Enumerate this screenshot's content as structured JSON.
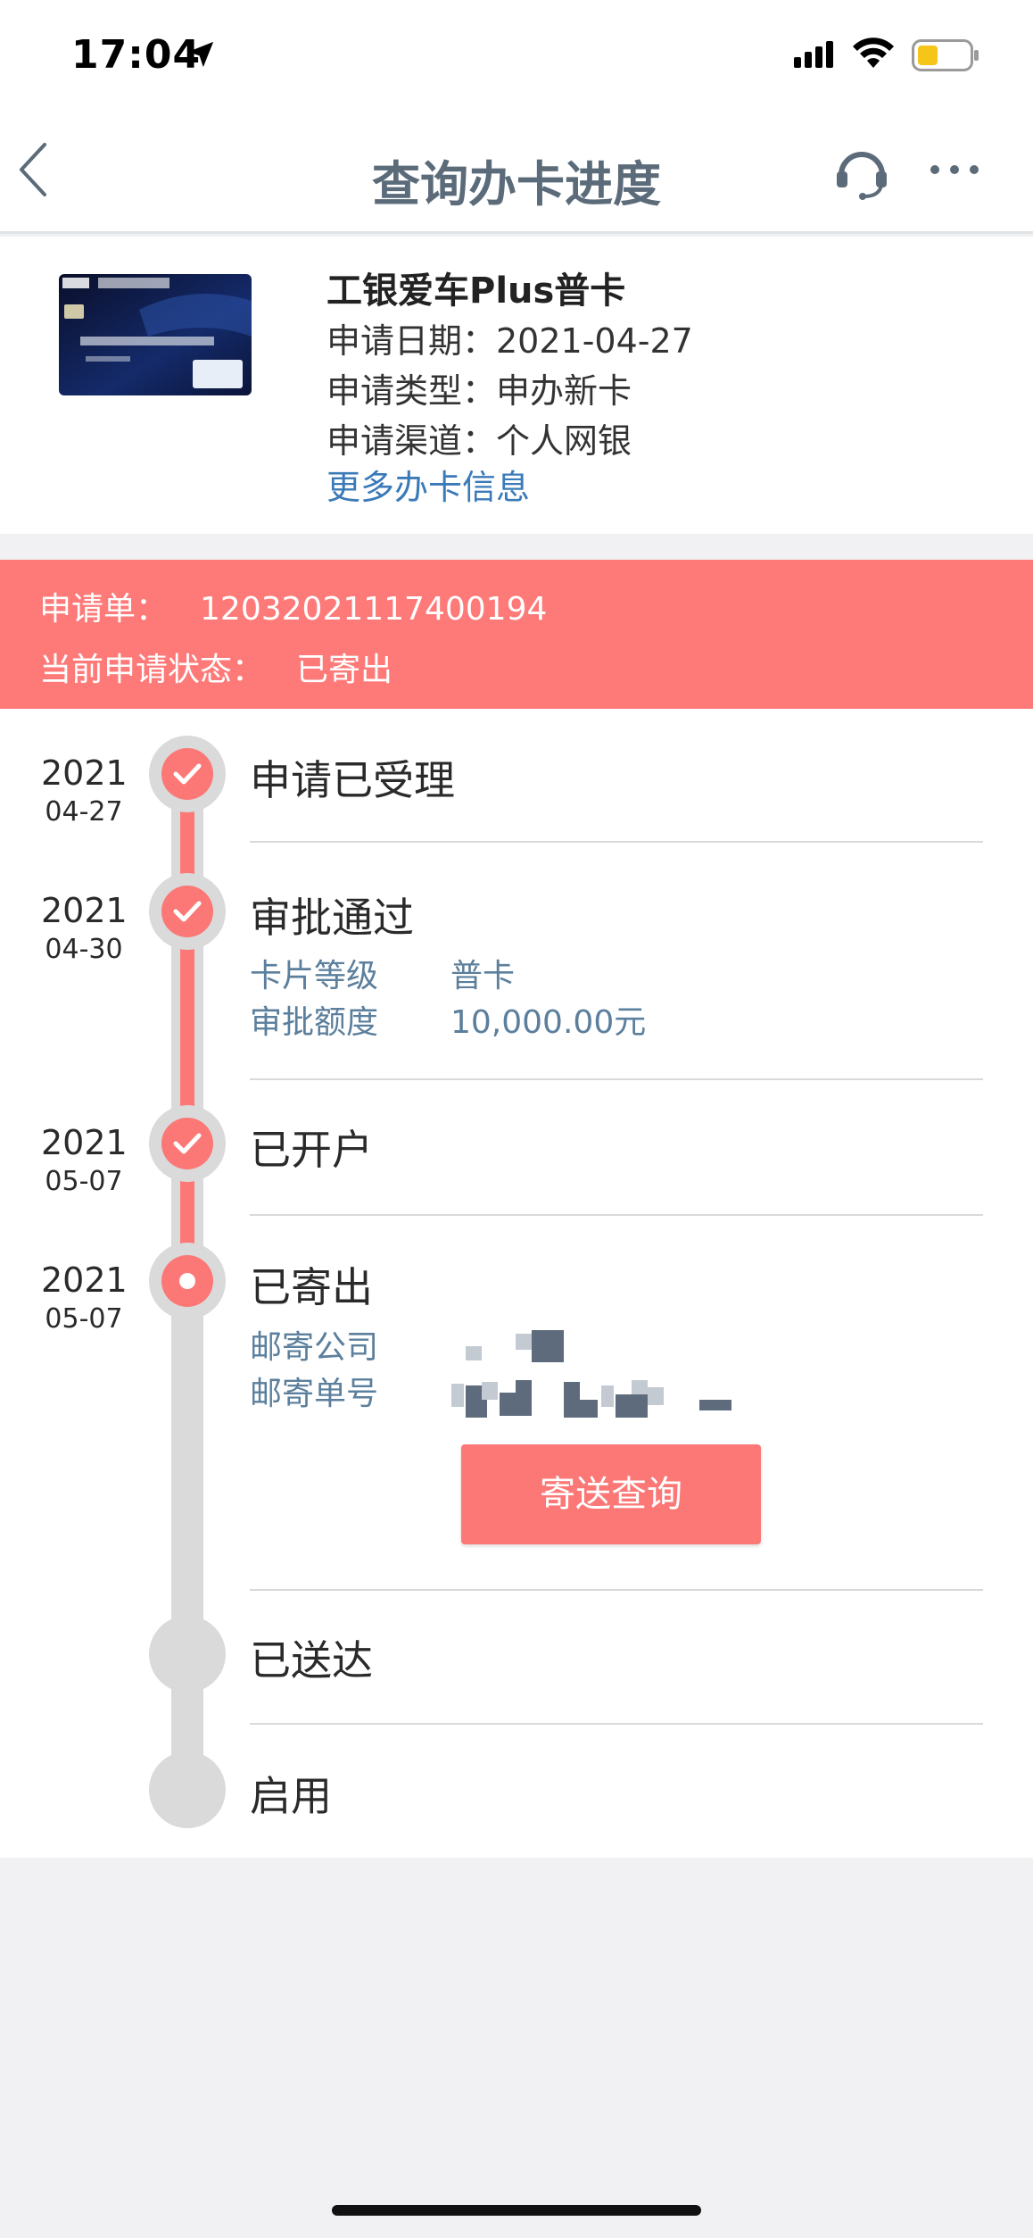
{
  "status_bar": {
    "time": "17:04",
    "icons": [
      "location-arrow-icon",
      "signal-icon",
      "wifi-icon",
      "battery-icon"
    ],
    "battery_color": "#f5c518"
  },
  "nav": {
    "title": "查询办卡进度",
    "icons": [
      "back-icon",
      "customer-service-icon",
      "more-icon"
    ]
  },
  "card": {
    "name": "工银爱车Plus普卡",
    "apply_date": "申请日期：2021-04-27",
    "apply_type": "申请类型：申办新卡",
    "apply_channel": "申请渠道：个人网银",
    "more_link": "更多办卡信息"
  },
  "banner": {
    "order_label": "申请单：",
    "order_number": "12032021117400194",
    "status_label": "当前申请状态：",
    "status_value": "已寄出",
    "color": "#fd7a78"
  },
  "timeline": {
    "accent_color": "#fb7876",
    "steps": [
      {
        "year": "2021",
        "md": "04-27",
        "title": "申请已受理",
        "state": "done"
      },
      {
        "year": "2021",
        "md": "04-30",
        "title": "审批通过",
        "state": "done",
        "details": [
          {
            "label": "卡片等级",
            "value": "普卡"
          },
          {
            "label": "审批额度",
            "value": "10,000.00元"
          }
        ]
      },
      {
        "year": "2021",
        "md": "05-07",
        "title": "已开户",
        "state": "done"
      },
      {
        "year": "2021",
        "md": "05-07",
        "title": "已寄出",
        "state": "current",
        "details": [
          {
            "label": "邮寄公司"
          },
          {
            "label": "邮寄单号"
          }
        ]
      },
      {
        "title": "已送达",
        "state": "pending"
      },
      {
        "title": "启用",
        "state": "pending"
      }
    ],
    "track_button": "寄送查询"
  }
}
